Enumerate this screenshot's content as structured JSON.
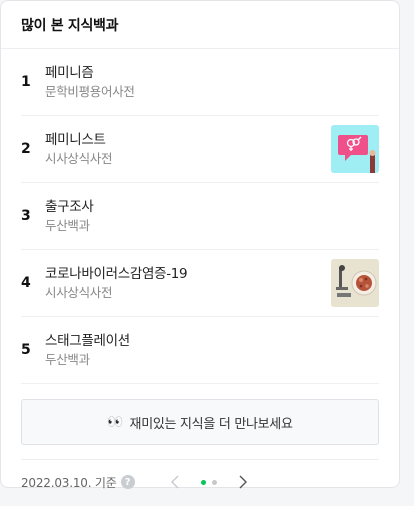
{
  "header": {
    "title": "많이 본 지식백과"
  },
  "items": [
    {
      "rank": "1",
      "title": "페미니즘",
      "source": "문학비평용어사전",
      "thumbnail": null
    },
    {
      "rank": "2",
      "title": "페미니스트",
      "source": "시사상식사전",
      "thumbnail": "feminism-symbol-speech-bubble"
    },
    {
      "rank": "3",
      "title": "출구조사",
      "source": "두산백과",
      "thumbnail": null
    },
    {
      "rank": "4",
      "title": "코로나바이러스감염증-19",
      "source": "시사상식사전",
      "thumbnail": "microscope-petri-dish"
    },
    {
      "rank": "5",
      "title": "스태그플레이션",
      "source": "두산백과",
      "thumbnail": null
    }
  ],
  "more_button": {
    "icon": "eyes-emoji",
    "label": "재미있는 지식을 더 만나보세요"
  },
  "footer": {
    "date": "2022.03.10. 기준",
    "help_icon": "question-icon",
    "help_glyph": "?",
    "pager": {
      "pages": 2,
      "current": 1
    }
  },
  "colors": {
    "accent": "#03c75a",
    "thumb_bg_1": "#9eeef3",
    "thumb_bubble": "#f0508a",
    "thumb_bg_2": "#e8e2d0"
  }
}
